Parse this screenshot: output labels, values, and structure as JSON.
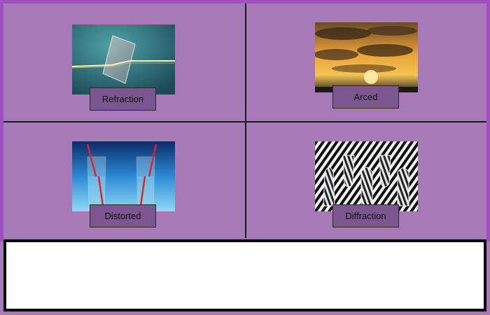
{
  "cards": [
    {
      "label": "Refraction",
      "image": "glass-block-light-beam"
    },
    {
      "label": "Arced",
      "image": "sunset-clouds"
    },
    {
      "label": "Distorted",
      "image": "straw-in-water-glasses"
    },
    {
      "label": "Diffraction",
      "image": "glasses-on-striped-background"
    }
  ],
  "answer_box": {
    "value": ""
  },
  "colors": {
    "background": "#a679b7",
    "label_button": "#7c578f",
    "frame": "#a04fbf"
  }
}
